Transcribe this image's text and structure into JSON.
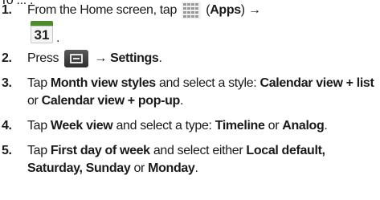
{
  "header": {
    "text": "To ... ."
  },
  "steps": [
    {
      "number": "1.",
      "text_before": "From the Home screen, tap",
      "apps_label": "Apps",
      "arrow": "→",
      "calendar_number": "31",
      "after_calendar": "."
    },
    {
      "number": "2.",
      "press": "Press",
      "arrow": "→",
      "settings": "Settings",
      "period": "."
    },
    {
      "number": "3.",
      "tap": "Tap",
      "item": "Month view styles",
      "mid": "and select a style:",
      "option1": "Calendar view + list",
      "or": "or",
      "option2": "Calendar view + pop-up",
      "period": "."
    },
    {
      "number": "4.",
      "tap": "Tap",
      "item": "Week view",
      "mid": "and select a type:",
      "option1": "Timeline",
      "or": "or",
      "option2": "Analog",
      "period": "."
    },
    {
      "number": "5.",
      "tap": "Tap",
      "item": "First day of week",
      "mid": "and select either",
      "option1": "Local default,",
      "option2": "Saturday, Sunday",
      "or": "or",
      "option3": "Monday",
      "period": "."
    }
  ],
  "colors": {
    "calendar_green": "#4c8c2a",
    "menu_icon_dark": "#3a3a3a"
  }
}
